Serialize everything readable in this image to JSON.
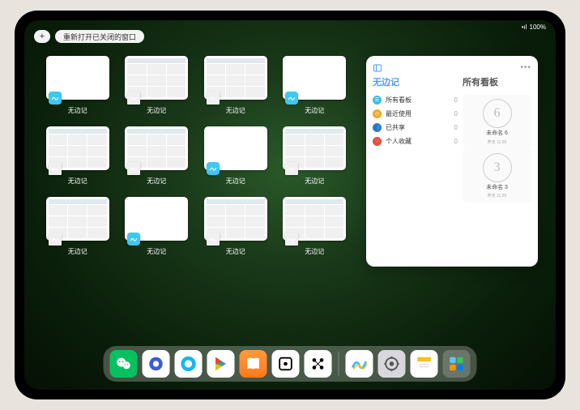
{
  "status": {
    "signal": "•ıl",
    "battery": "100%"
  },
  "topbar": {
    "plus": "+",
    "reopen_label": "重新打开已关闭的窗口"
  },
  "windows": [
    {
      "label": "无边记",
      "type": "blank"
    },
    {
      "label": "无边记",
      "type": "cal"
    },
    {
      "label": "无边记",
      "type": "cal"
    },
    {
      "label": "无边记",
      "type": "blank"
    },
    {
      "label": "无边记",
      "type": "cal"
    },
    {
      "label": "无边记",
      "type": "cal"
    },
    {
      "label": "无边记",
      "type": "blank"
    },
    {
      "label": "无边记",
      "type": "cal"
    },
    {
      "label": "无边记",
      "type": "cal"
    },
    {
      "label": "无边记",
      "type": "blank"
    },
    {
      "label": "无边记",
      "type": "cal"
    },
    {
      "label": "无边记",
      "type": "cal"
    }
  ],
  "popup": {
    "left_title": "无边记",
    "right_title": "所有看板",
    "menu": [
      {
        "iconColor": "#3bbde6",
        "glyph": "☰",
        "label": "所有看板",
        "count": "0"
      },
      {
        "iconColor": "#f5a623",
        "glyph": "◴",
        "label": "最近使用",
        "count": "0"
      },
      {
        "iconColor": "#3a75c4",
        "glyph": "👥",
        "label": "已共享",
        "count": "0"
      },
      {
        "iconColor": "#e74c3c",
        "glyph": "♡",
        "label": "个人收藏",
        "count": "0"
      }
    ],
    "boards": [
      {
        "glyph": "6",
        "label": "未命名 6",
        "sub": "昨天 11:26"
      },
      {
        "glyph": "3",
        "label": "未命名 3",
        "sub": "昨天 11:25"
      }
    ]
  },
  "dock": {
    "apps": [
      {
        "name": "wechat",
        "bg": "#07c160"
      },
      {
        "name": "quark-hd",
        "bg": "#fff"
      },
      {
        "name": "qq",
        "bg": "#fff"
      },
      {
        "name": "play",
        "bg": "#fff"
      },
      {
        "name": "books",
        "bg": "linear-gradient(#ff9a3d,#ff7a1a)"
      },
      {
        "name": "dice",
        "bg": "#fff"
      },
      {
        "name": "dots",
        "bg": "#fff"
      },
      {
        "name": "freeform",
        "bg": "#fff"
      },
      {
        "name": "settings",
        "bg": "#d8d8dc"
      },
      {
        "name": "notes",
        "bg": "#fff"
      },
      {
        "name": "app-library",
        "bg": "rgba(255,255,255,.2)"
      }
    ]
  }
}
